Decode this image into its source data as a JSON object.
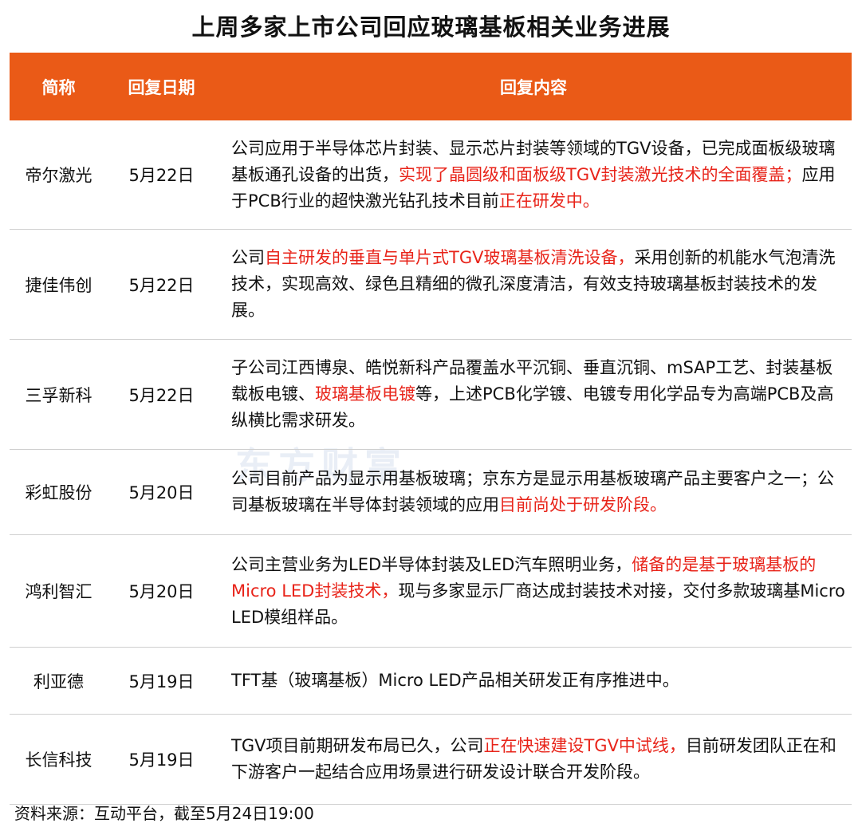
{
  "title": "上周多家上市公司回应玻璃基板相关业务进展",
  "header": {
    "col1": "简称",
    "col2": "回复日期",
    "col3": "回复内容"
  },
  "rows": [
    {
      "name": "帝尔激光",
      "date": "5月22日",
      "segments": [
        {
          "text": "公司应用于半导体芯片封装、显示芯片封装等领域的TGV设备，已完成面板级玻璃基板通孔设备的出货，",
          "highlight": false
        },
        {
          "text": "实现了晶圆级和面板级TGV封装激光技术的全面覆盖；",
          "highlight": true
        },
        {
          "text": "应用于PCB行业的超快激光钻孔技术目前",
          "highlight": false
        },
        {
          "text": "正在研发中。",
          "highlight": true
        }
      ]
    },
    {
      "name": "捷佳伟创",
      "date": "5月22日",
      "segments": [
        {
          "text": "公司",
          "highlight": false
        },
        {
          "text": "自主研发的垂直与单片式TGV玻璃基板清洗设备，",
          "highlight": true
        },
        {
          "text": "采用创新的机能水气泡清洗技术，实现高效、绿色且精细的微孔深度清洁，有效支持玻璃基板封装技术的发展。",
          "highlight": false
        }
      ]
    },
    {
      "name": "三孚新科",
      "date": "5月22日",
      "segments": [
        {
          "text": "子公司江西博泉、皓悦新科产品覆盖水平沉铜、垂直沉铜、mSAP工艺、封装基板载板电镀、",
          "highlight": false
        },
        {
          "text": "玻璃基板电镀",
          "highlight": true
        },
        {
          "text": "等，上述PCB化学镀、电镀专用化学品专为高端PCB及高纵横比需求研发。",
          "highlight": false
        }
      ]
    },
    {
      "name": "彩虹股份",
      "date": "5月20日",
      "segments": [
        {
          "text": "公司目前产品为显示用基板玻璃；京东方是显示用基板玻璃产品主要客户之一；公司基板玻璃在半导体封装领域的应用",
          "highlight": false
        },
        {
          "text": "目前尚处于研发阶段。",
          "highlight": true
        }
      ]
    },
    {
      "name": "鸿利智汇",
      "date": "5月20日",
      "segments": [
        {
          "text": "公司主营业务为LED半导体封装及LED汽车照明业务，",
          "highlight": false
        },
        {
          "text": "储备的是基于玻璃基板的Micro LED封装技术，",
          "highlight": true
        },
        {
          "text": "现与多家显示厂商达成封装技术对接，交付多款玻璃基Micro LED模组样品。",
          "highlight": false
        }
      ]
    },
    {
      "name": "利亚德",
      "date": "5月19日",
      "segments": [
        {
          "text": "TFT基（玻璃基板）Micro LED产品相关研发正有序推进中。",
          "highlight": false
        }
      ]
    },
    {
      "name": "长信科技",
      "date": "5月19日",
      "segments": [
        {
          "text": "TGV项目前期研发布局已久，公司",
          "highlight": false
        },
        {
          "text": "正在快速建设TGV中试线，",
          "highlight": true
        },
        {
          "text": "目前研发团队正在和下游客户一起结合应用场景进行研发设计联合开发阶段。",
          "highlight": false
        }
      ]
    }
  ],
  "source": "资料来源：互动平台，截至5月24日19:00",
  "watermark": "东方财富",
  "colors": {
    "header_bg": "#EA5A17",
    "highlight": "#E8241A",
    "divider": "#cfcfcf"
  }
}
